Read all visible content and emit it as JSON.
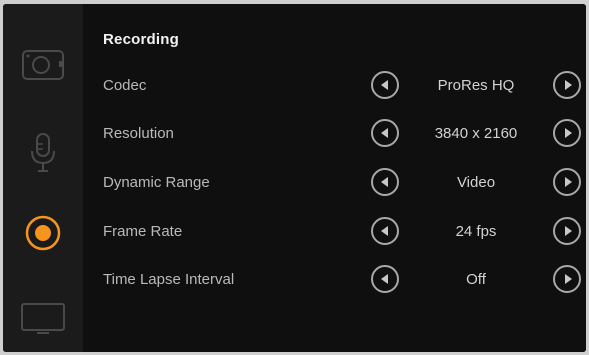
{
  "panel": {
    "title": "Recording"
  },
  "sidebar": {
    "items": [
      {
        "icon": "camera-icon",
        "active": false
      },
      {
        "icon": "microphone-icon",
        "active": false
      },
      {
        "icon": "record-icon",
        "active": true,
        "accent": "#f7941d"
      },
      {
        "icon": "monitor-icon",
        "active": false
      }
    ]
  },
  "settings": [
    {
      "label": "Codec",
      "value": "ProRes HQ"
    },
    {
      "label": "Resolution",
      "value": "3840 x 2160"
    },
    {
      "label": "Dynamic Range",
      "value": "Video"
    },
    {
      "label": "Frame Rate",
      "value": "24 fps"
    },
    {
      "label": "Time Lapse Interval",
      "value": "Off"
    }
  ],
  "colors": {
    "accent": "#f7941d",
    "background": "#0f0f0f",
    "sidebar": "#1b1b1b"
  }
}
